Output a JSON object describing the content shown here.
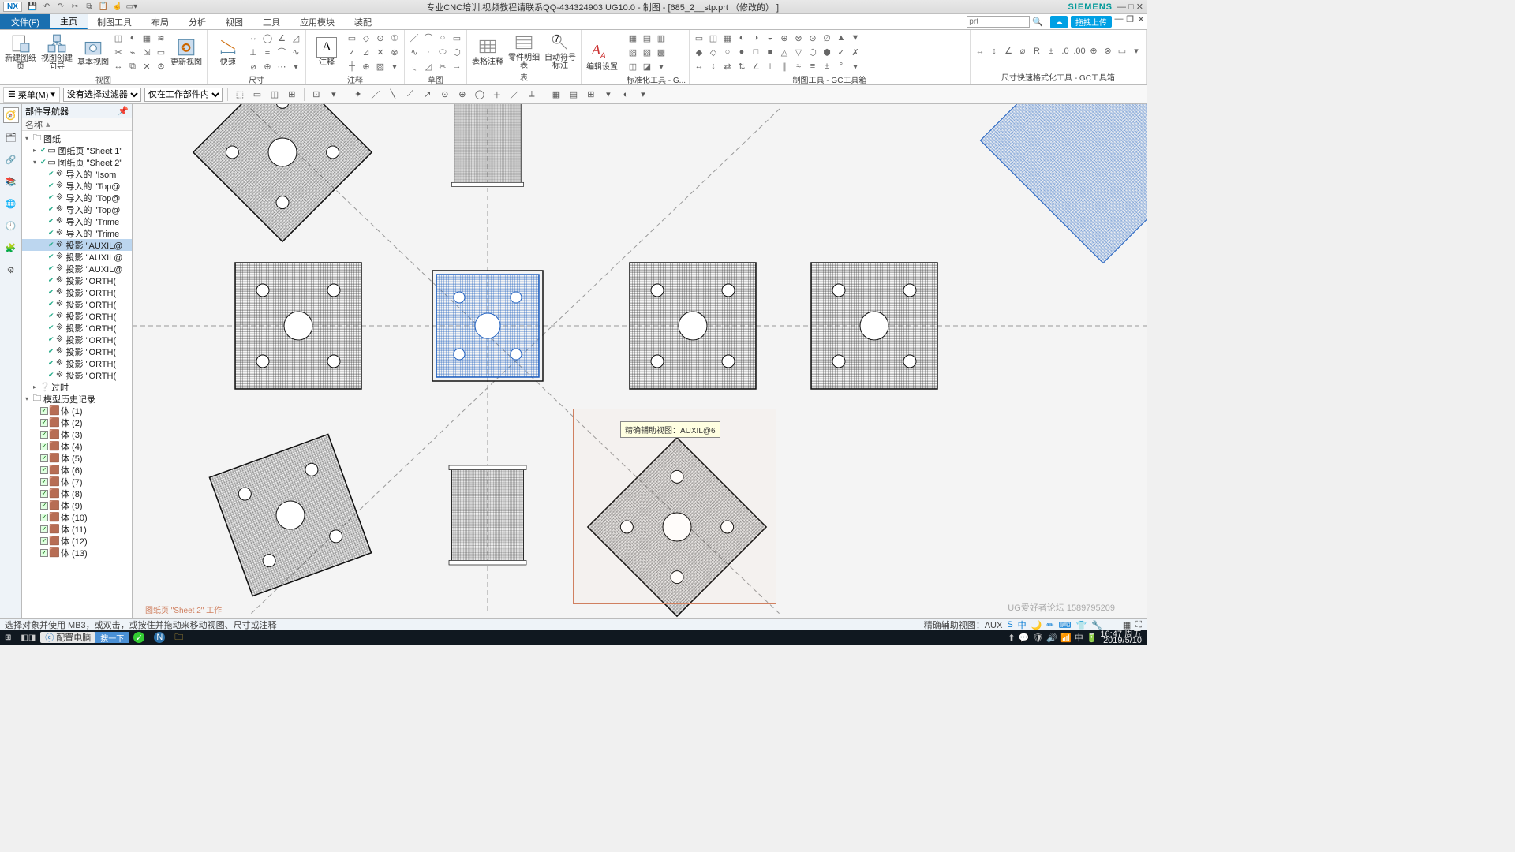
{
  "app": {
    "logo": "NX",
    "brand": "SIEMENS"
  },
  "title": "专业CNC培训.视频教程请联系QQ-434324903 UG10.0 - 制图 - [685_2__stp.prt （修改的） ]",
  "file_menu": "文件(F)",
  "tabs": [
    "主页",
    "制图工具",
    "布局",
    "分析",
    "视图",
    "工具",
    "应用模块",
    "装配"
  ],
  "active_tab": 0,
  "search_placeholder": "prt",
  "upload_label": "拖拽上传",
  "ribbon": {
    "g1": {
      "label": "视图",
      "big1": "新建图纸页",
      "big2": "视图创建向导",
      "big3": "基本视图",
      "big4": "更新视图"
    },
    "g2": {
      "label": "尺寸",
      "big": "快速"
    },
    "g3": {
      "label": "注释",
      "big": "注释"
    },
    "g4": {
      "label": "草图"
    },
    "g5": {
      "label": "表",
      "big1": "表格注释",
      "big2": "零件明细表",
      "big3": "自动符号标注"
    },
    "g6": {
      "label": "",
      "big": "编辑设置"
    },
    "g7": {
      "label": "标准化工具 - G..."
    },
    "g8": {
      "label": "制图工具 - GC工具箱"
    },
    "g9": {
      "label": "尺寸快速格式化工具 - GC工具箱"
    }
  },
  "optbar": {
    "menu": "菜单(M)",
    "filter1": "没有选择过滤器",
    "filter2": "仅在工作部件内"
  },
  "nav": {
    "title": "部件导航器",
    "col": "名称",
    "root": "图纸",
    "sheet1": "图纸页 \"Sheet 1\"",
    "sheet2": "图纸页 \"Sheet 2\"",
    "items": [
      "导入的 \"Isom",
      "导入的 \"Top@",
      "导入的 \"Top@",
      "导入的 \"Top@",
      "导入的 \"Trime",
      "导入的 \"Trime"
    ],
    "proj_sel": "投影 \"AUXIL@",
    "proj_items": [
      "投影 \"AUXIL@",
      "投影 \"AUXIL@",
      "投影 \"ORTH(",
      "投影 \"ORTH(",
      "投影 \"ORTH(",
      "投影 \"ORTH(",
      "投影 \"ORTH(",
      "投影 \"ORTH(",
      "投影 \"ORTH(",
      "投影 \"ORTH(",
      "投影 \"ORTH("
    ],
    "outdate": "过时",
    "history": "模型历史记录",
    "bodies": [
      "体 (1)",
      "体 (2)",
      "体 (3)",
      "体 (4)",
      "体 (5)",
      "体 (6)",
      "体 (7)",
      "体 (8)",
      "体 (9)",
      "体 (10)",
      "体 (11)",
      "体 (12)",
      "体 (13)"
    ]
  },
  "canvas": {
    "sheet_label": "图纸页 \"Sheet 2\" 工作",
    "tooltip": "精确辅助视图：AUXIL@6"
  },
  "status": {
    "left": "选择对象并使用 MB3，或双击，或按住并拖动来移动视图、尺寸或注释",
    "right": "精确辅助视图：AUX"
  },
  "taskbar": {
    "browser": "配置电脑",
    "search": "搜一下",
    "time": "16:47",
    "date": "周五",
    "date2": "2019/5/10"
  },
  "watermark": "UG爱好者论坛 1589795209"
}
